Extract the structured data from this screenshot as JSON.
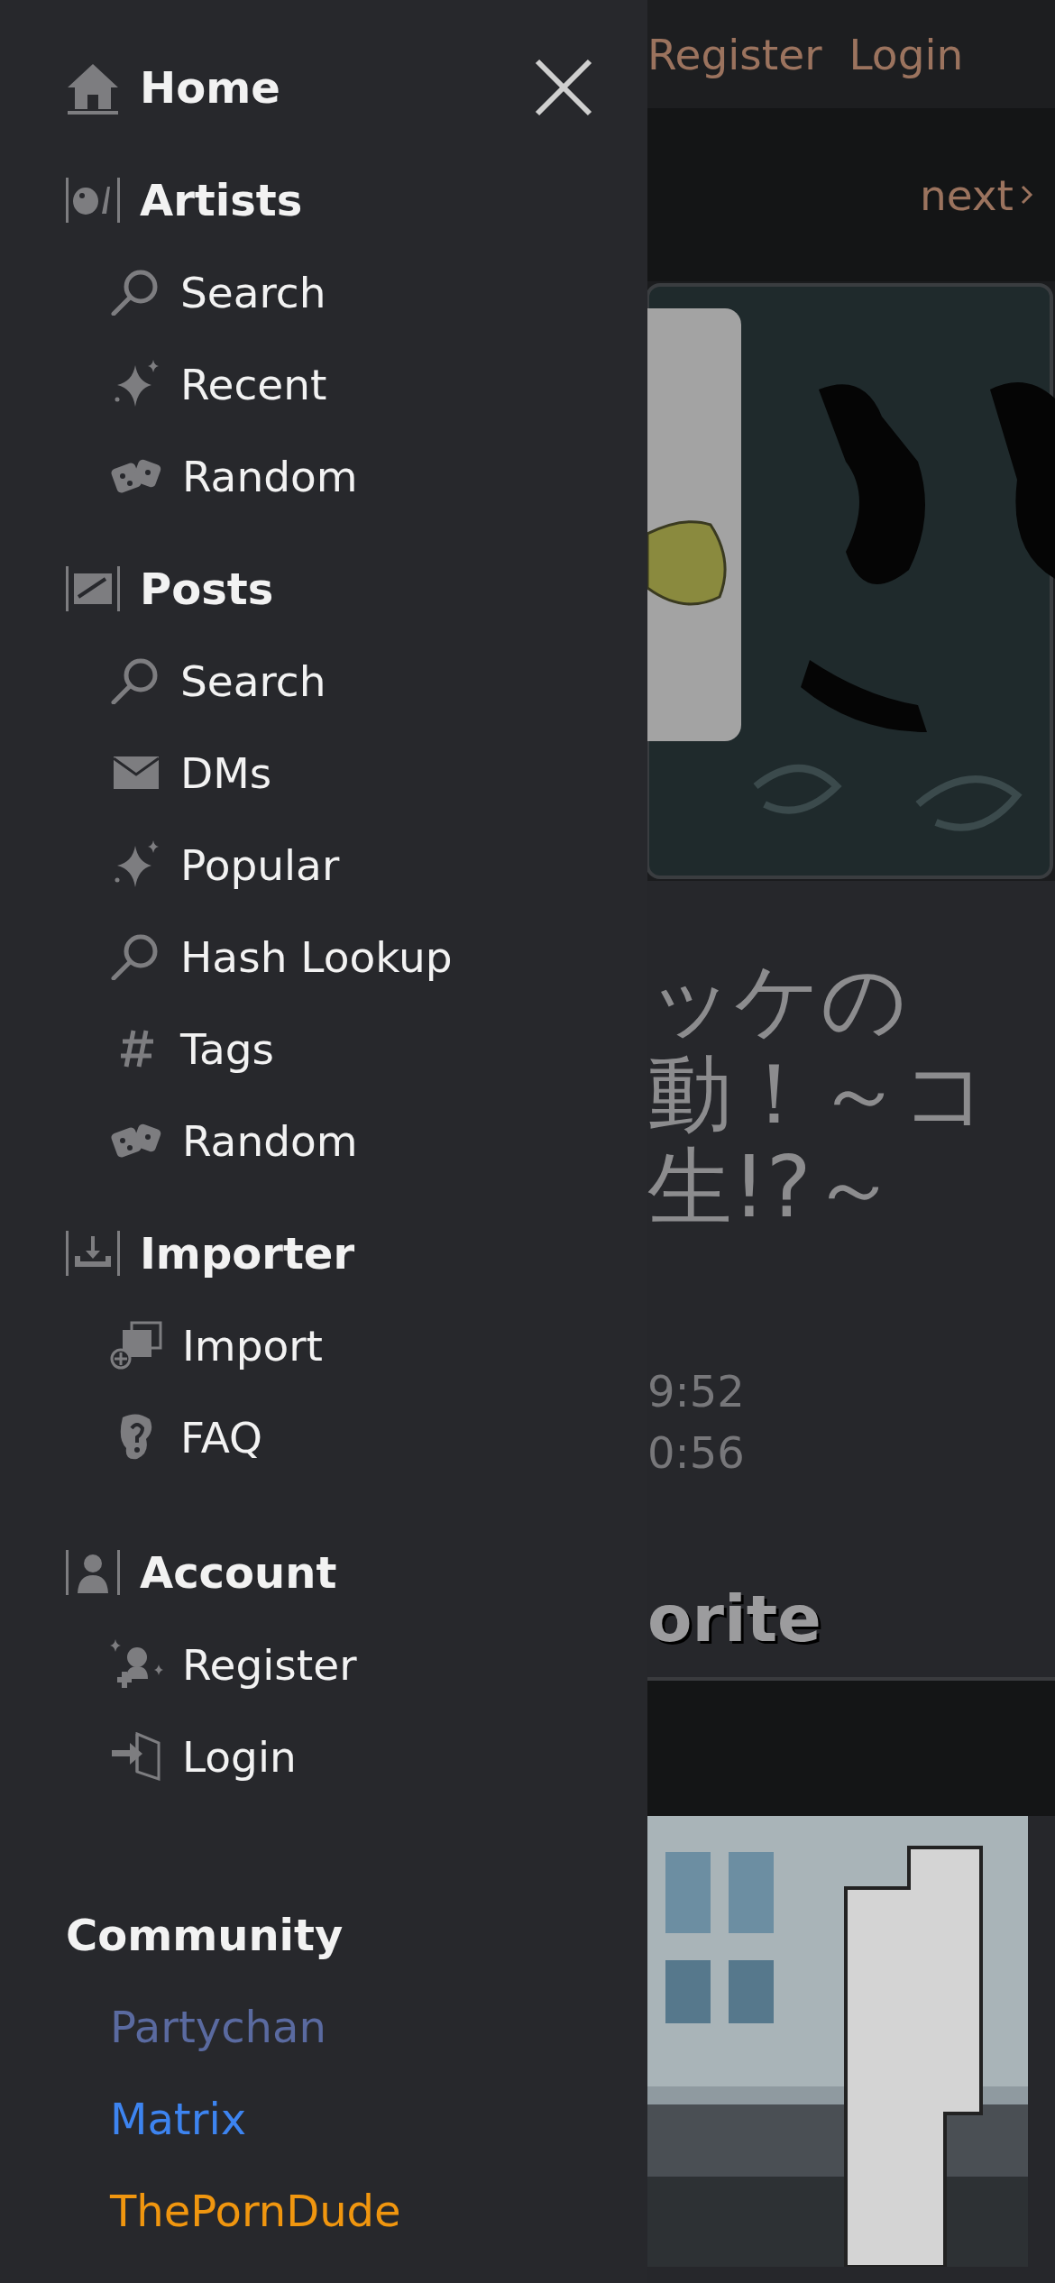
{
  "menu": {
    "sections": [
      {
        "title": "Home",
        "kind": "home"
      },
      {
        "title": "Artists",
        "kind": "palette",
        "items": [
          {
            "label": "Search",
            "kind": "search"
          },
          {
            "label": "Recent",
            "kind": "sparkle"
          },
          {
            "label": "Random",
            "kind": "dice"
          }
        ]
      },
      {
        "title": "Posts",
        "kind": "post",
        "items": [
          {
            "label": "Search",
            "kind": "search"
          },
          {
            "label": "DMs",
            "kind": "mail"
          },
          {
            "label": "Popular",
            "kind": "sparkle"
          },
          {
            "label": "Hash Lookup",
            "kind": "search"
          },
          {
            "label": "Tags",
            "kind": "hash"
          },
          {
            "label": "Random",
            "kind": "dice"
          }
        ]
      },
      {
        "title": "Importer",
        "kind": "import",
        "items": [
          {
            "label": "Import",
            "kind": "add"
          },
          {
            "label": "FAQ",
            "kind": "question"
          }
        ]
      },
      {
        "title": "Account",
        "kind": "account",
        "items": [
          {
            "label": "Register",
            "kind": "register"
          },
          {
            "label": "Login",
            "kind": "login"
          }
        ]
      }
    ],
    "community": {
      "title": "Community",
      "links": [
        {
          "label": "Partychan",
          "color": "#5a6aa0"
        },
        {
          "label": "Matrix",
          "color": "#3d84f0"
        },
        {
          "label": "ThePornDude",
          "color": "#f0960f"
        }
      ]
    }
  },
  "page": {
    "header_links": [
      "Register",
      "Login"
    ],
    "pager": "next",
    "title_lines": [
      "ッケの",
      "動！～コ",
      "生!?～"
    ],
    "times": [
      "9:52",
      "0:56"
    ],
    "heading": "orite"
  }
}
